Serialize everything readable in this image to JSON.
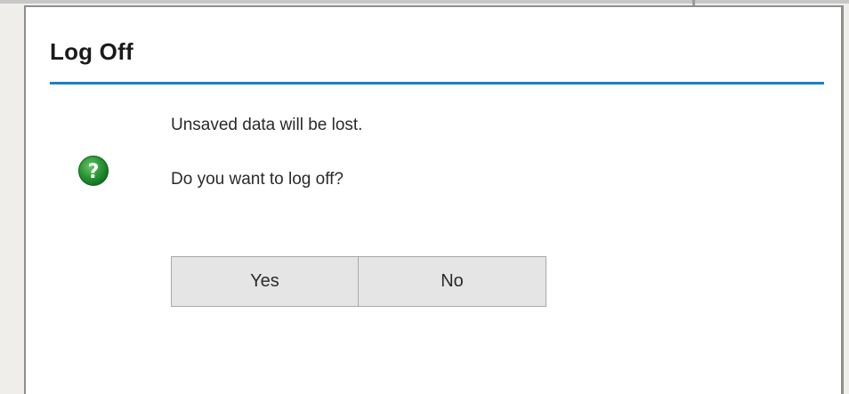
{
  "dialog": {
    "title": "Log Off",
    "icon": "question-icon",
    "messages": [
      "Unsaved data will be lost.",
      "Do you want to log off?"
    ],
    "buttons": {
      "yes_label": "Yes",
      "no_label": "No"
    }
  },
  "colors": {
    "title_rule": "#1b7fc4",
    "icon_green": "#1e8a2d",
    "button_bg": "#e5e5e5"
  }
}
